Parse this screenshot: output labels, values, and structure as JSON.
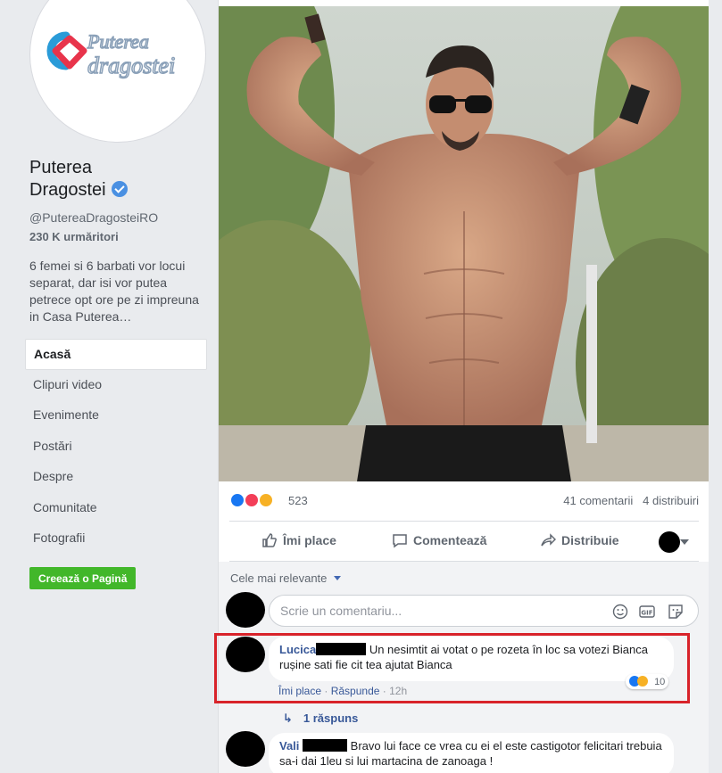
{
  "sidebar": {
    "logo_line1": "Puterea",
    "logo_line2": "dragostei",
    "page_name_line1": "Puterea",
    "page_name_line2": "Dragostei",
    "handle": "@PutereaDragosteiRO",
    "followers": "230 K urmăritori",
    "about": "6 femei si 6 barbati vor locui separat, dar isi vor putea petrece opt ore pe zi impreuna in Casa Puterea…",
    "nav": [
      "Acasă",
      "Clipuri video",
      "Evenimente",
      "Postări",
      "Despre",
      "Comunitate",
      "Fotografii"
    ],
    "create_page": "Creează o Pagină"
  },
  "post": {
    "reaction_count": "523",
    "comments_count": "41 comentarii",
    "shares_count": "4 distribuiri",
    "actions": {
      "like": "Îmi place",
      "comment": "Comentează",
      "share": "Distribuie"
    },
    "sort_label": "Cele mai relevante",
    "comment_placeholder": "Scrie un comentariu..."
  },
  "comments": [
    {
      "author": "Lucica",
      "text": "Un nesimtit ai votat o pe rozeta în loc sa votezi Bianca rușine sati fie cit tea ajutat Bianca",
      "like": "Îmi place",
      "reply": "Răspunde",
      "time": "12h",
      "reactions": "10"
    },
    {
      "author": "Vali",
      "text": "Bravo lui face ce vrea cu ei el este castigotor felicitari trebuia sa-i dai 1leu si lui martacina de zanoaga !"
    }
  ],
  "replies_label": "1 răspuns",
  "colors": {
    "highlight": "#d8232a",
    "link": "#385898",
    "create_button": "#42b72a",
    "verified": "#4a90e2"
  }
}
